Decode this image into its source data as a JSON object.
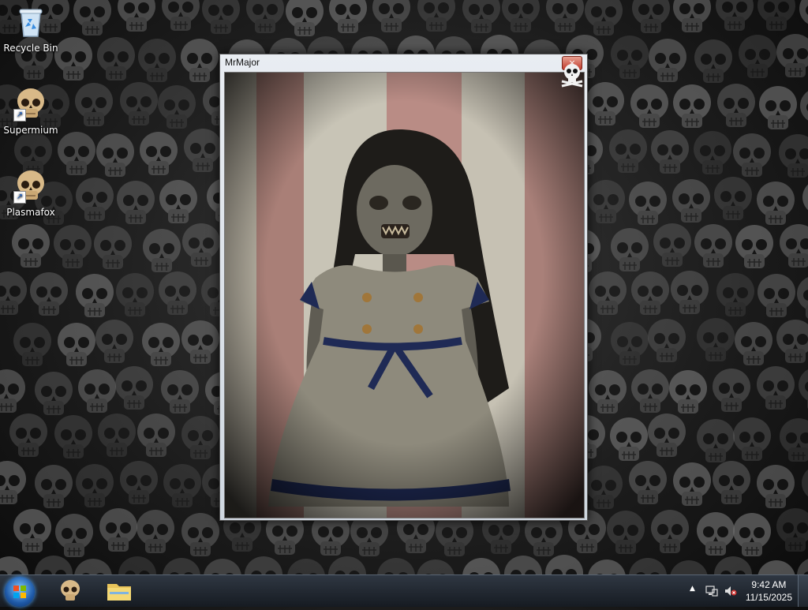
{
  "desktop": {
    "icons": [
      {
        "label": "Recycle Bin",
        "icon": "recycle-bin-icon"
      },
      {
        "label": "Supermium",
        "icon": "skull-icon"
      },
      {
        "label": "Plasmafox",
        "icon": "skull-icon"
      }
    ]
  },
  "window": {
    "title": "MrMajor",
    "close_symbol": "×",
    "content_image": "creepy-doll-photo"
  },
  "taskbar": {
    "start_icon": "windows-orb-icon",
    "pinned": [
      {
        "name": "skull-app",
        "icon": "skull-icon"
      },
      {
        "name": "explorer",
        "icon": "folder-icon"
      }
    ],
    "tray": {
      "show_hidden": "▲",
      "time": "9:42 AM",
      "date": "11/15/2025"
    }
  }
}
